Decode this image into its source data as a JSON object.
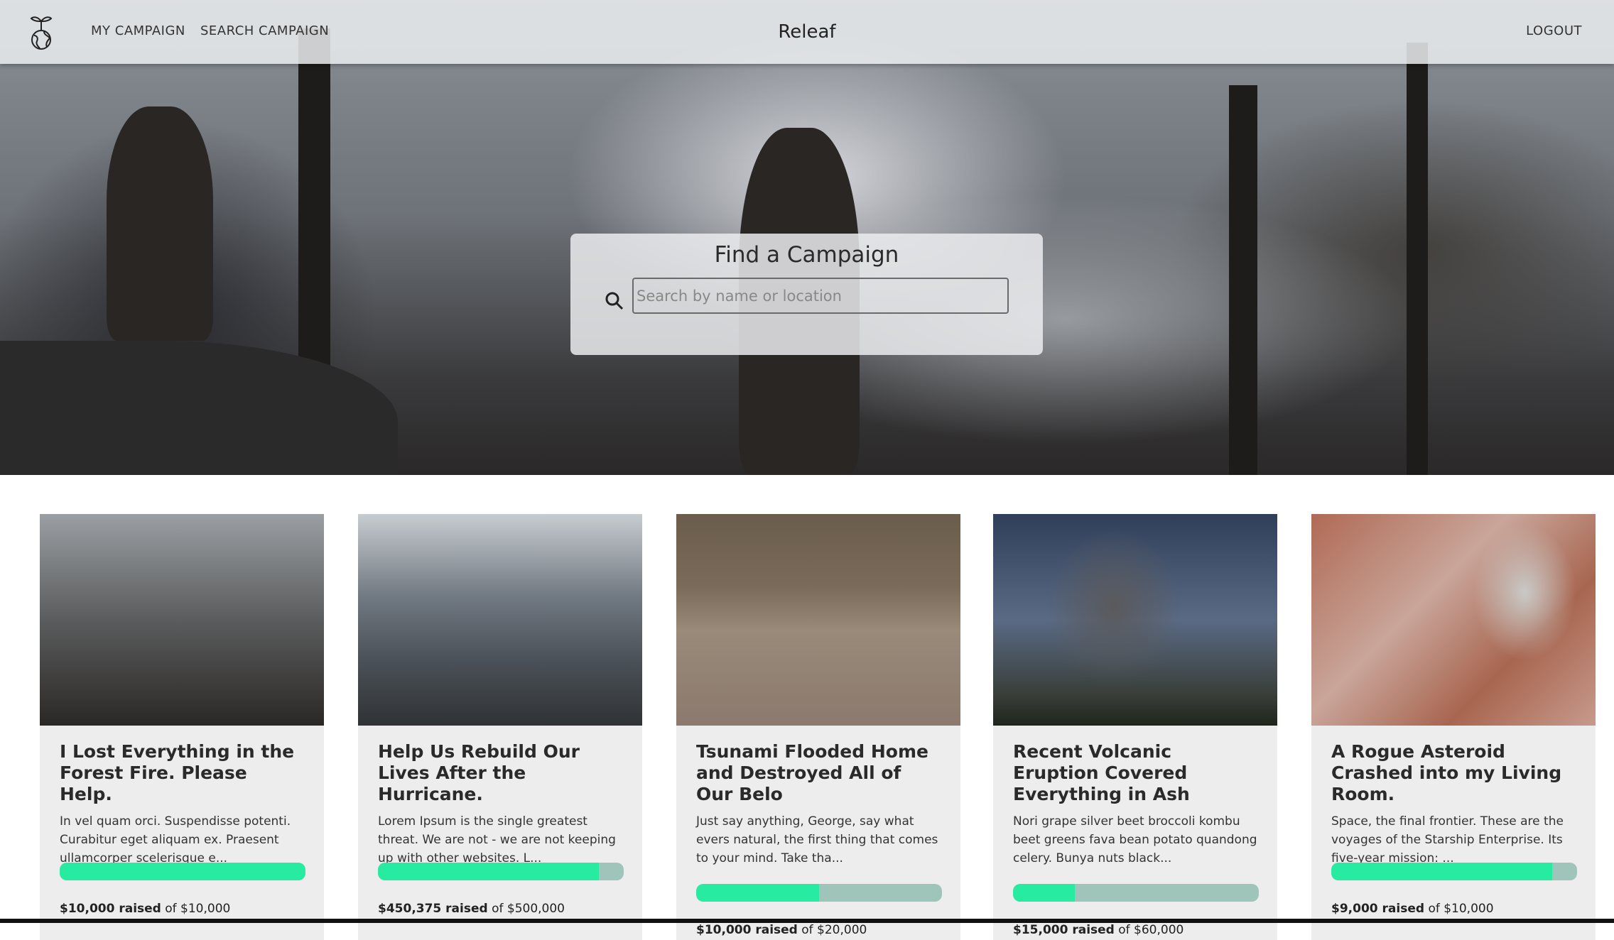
{
  "nav": {
    "links": [
      "MY CAMPAIGN",
      "SEARCH CAMPAIGN"
    ],
    "brand": "Releaf",
    "logout": "LOGOUT"
  },
  "search": {
    "title": "Find a Campaign",
    "placeholder": "Search by name or location"
  },
  "colors": {
    "progress": "#27eba0",
    "track": "#9fc5bb",
    "card": "#ededed"
  },
  "cards": [
    {
      "title": "I Lost Everything in the Forest Fire. Please Help.",
      "desc": "In vel quam orci. Suspendisse potenti. Curabitur eget aliquam ex. Praesent ullamcorper scelerisque e...",
      "raised": "$10,000 raised",
      "goal": "of $10,000",
      "progress": 1.0
    },
    {
      "title": "Help Us Rebuild Our Lives After the Hurricane.",
      "desc": "Lorem Ipsum is the single greatest threat. We are not - we are not keeping up with other websites. L...",
      "raised": "$450,375 raised",
      "goal": "of $500,000",
      "progress": 0.9
    },
    {
      "title": "Tsunami Flooded Home and Destroyed All of Our Belo",
      "desc": "Just say anything, George, say what evers natural, the first thing that comes to your mind. Take tha...",
      "raised": "$10,000 raised",
      "goal": "of $20,000",
      "progress": 0.5
    },
    {
      "title": "Recent Volcanic Eruption Covered Everything in Ash",
      "desc": "Nori grape silver beet broccoli kombu beet greens fava bean potato quandong celery. Bunya nuts black...",
      "raised": "$15,000 raised",
      "goal": "of $60,000",
      "progress": 0.25
    },
    {
      "title": "A Rogue Asteroid Crashed into my Living Room.",
      "desc": "Space, the final frontier. These are the voyages of the Starship Enterprise. Its five-year mission: ...",
      "raised": "$9,000 raised",
      "goal": "of $10,000",
      "progress": 0.9
    }
  ]
}
